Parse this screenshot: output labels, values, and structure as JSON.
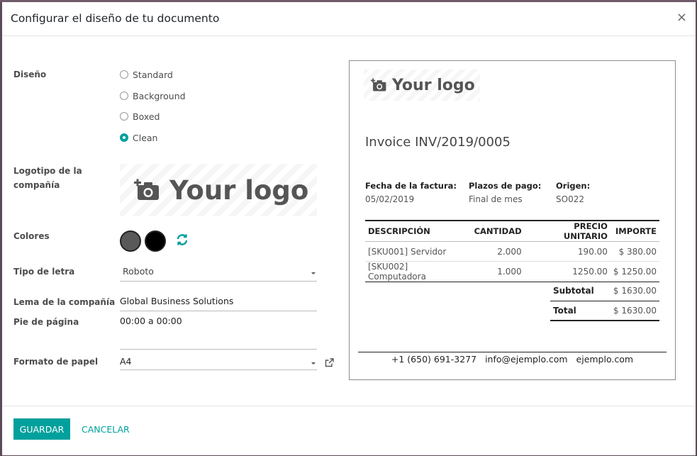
{
  "dialog": {
    "title": "Configurar el diseño de tu documento",
    "close_label": "×"
  },
  "form": {
    "layout_label": "Diseño",
    "layout_options": [
      "Standard",
      "Background",
      "Boxed",
      "Clean"
    ],
    "layout_selected": "Clean",
    "logo_label": "Logotipo de la compañía",
    "logo_placeholder": "Your logo",
    "colors_label": "Colores",
    "colors": [
      "#595959",
      "#000000"
    ],
    "accent_color": "#00a09d",
    "font_label": "Tipo de letra",
    "font_value": "Roboto",
    "tagline_label": "Lema de la compañía",
    "tagline_value": "Global Business Solutions",
    "footer_label": "Pie de página",
    "footer_value": "00:00 a 00:00",
    "paper_label": "Formato de papel",
    "paper_value": "A4"
  },
  "preview": {
    "logo_placeholder": "Your logo",
    "invoice_title": "Invoice INV/2019/0005",
    "meta": [
      {
        "label": "Fecha de la factura:",
        "value": "05/02/2019"
      },
      {
        "label": "Plazos de pago:",
        "value": "Final de mes"
      },
      {
        "label": "Origen:",
        "value": "SO022"
      }
    ],
    "columns": [
      "DESCRIPCIÓN",
      "CANTIDAD",
      "PRECIO UNITARIO",
      "IMPORTE"
    ],
    "rows": [
      [
        "[SKU001] Servidor",
        "2.000",
        "190.00",
        "$ 380.00"
      ],
      [
        "[SKU002] Computadora",
        "1.000",
        "1250.00",
        "$ 1250.00"
      ]
    ],
    "subtotal_label": "Subtotal",
    "subtotal_value": "$ 1630.00",
    "total_label": "Total",
    "total_value": "$ 1630.00",
    "footer_phone": "+1 (650) 691-3277",
    "footer_email": "info@ejemplo.com",
    "footer_web": "ejemplo.com"
  },
  "buttons": {
    "save": "GUARDAR",
    "cancel": "CANCELAR"
  }
}
